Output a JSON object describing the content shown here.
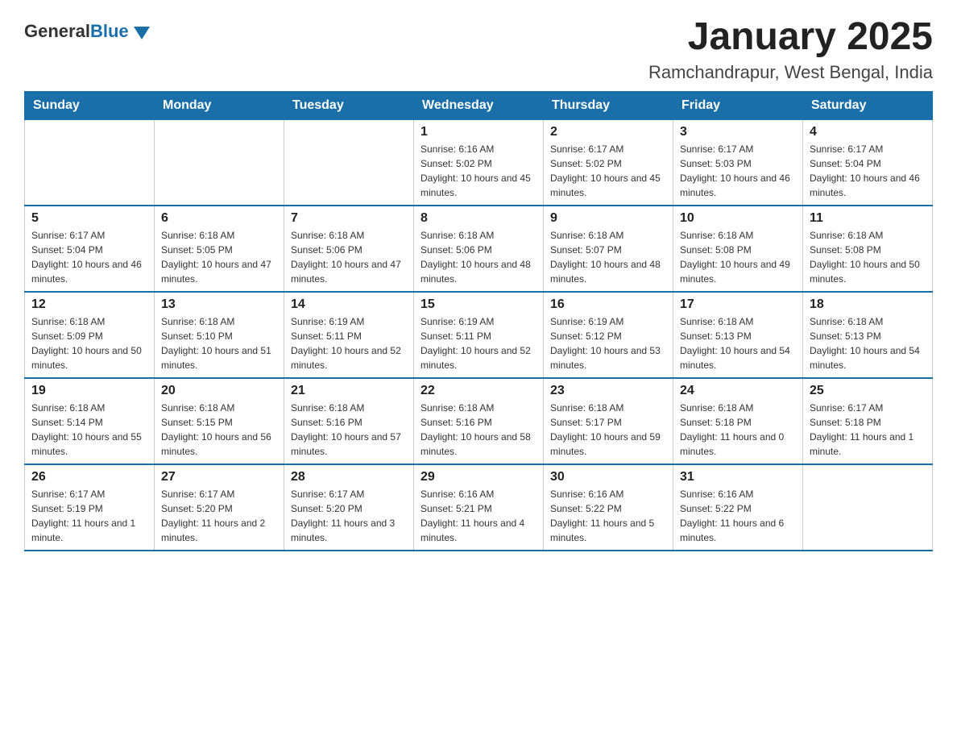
{
  "logo": {
    "text_general": "General",
    "text_blue": "Blue"
  },
  "title": "January 2025",
  "subtitle": "Ramchandrapur, West Bengal, India",
  "weekdays": [
    "Sunday",
    "Monday",
    "Tuesday",
    "Wednesday",
    "Thursday",
    "Friday",
    "Saturday"
  ],
  "weeks": [
    [
      {
        "day": "",
        "info": ""
      },
      {
        "day": "",
        "info": ""
      },
      {
        "day": "",
        "info": ""
      },
      {
        "day": "1",
        "info": "Sunrise: 6:16 AM\nSunset: 5:02 PM\nDaylight: 10 hours and 45 minutes."
      },
      {
        "day": "2",
        "info": "Sunrise: 6:17 AM\nSunset: 5:02 PM\nDaylight: 10 hours and 45 minutes."
      },
      {
        "day": "3",
        "info": "Sunrise: 6:17 AM\nSunset: 5:03 PM\nDaylight: 10 hours and 46 minutes."
      },
      {
        "day": "4",
        "info": "Sunrise: 6:17 AM\nSunset: 5:04 PM\nDaylight: 10 hours and 46 minutes."
      }
    ],
    [
      {
        "day": "5",
        "info": "Sunrise: 6:17 AM\nSunset: 5:04 PM\nDaylight: 10 hours and 46 minutes."
      },
      {
        "day": "6",
        "info": "Sunrise: 6:18 AM\nSunset: 5:05 PM\nDaylight: 10 hours and 47 minutes."
      },
      {
        "day": "7",
        "info": "Sunrise: 6:18 AM\nSunset: 5:06 PM\nDaylight: 10 hours and 47 minutes."
      },
      {
        "day": "8",
        "info": "Sunrise: 6:18 AM\nSunset: 5:06 PM\nDaylight: 10 hours and 48 minutes."
      },
      {
        "day": "9",
        "info": "Sunrise: 6:18 AM\nSunset: 5:07 PM\nDaylight: 10 hours and 48 minutes."
      },
      {
        "day": "10",
        "info": "Sunrise: 6:18 AM\nSunset: 5:08 PM\nDaylight: 10 hours and 49 minutes."
      },
      {
        "day": "11",
        "info": "Sunrise: 6:18 AM\nSunset: 5:08 PM\nDaylight: 10 hours and 50 minutes."
      }
    ],
    [
      {
        "day": "12",
        "info": "Sunrise: 6:18 AM\nSunset: 5:09 PM\nDaylight: 10 hours and 50 minutes."
      },
      {
        "day": "13",
        "info": "Sunrise: 6:18 AM\nSunset: 5:10 PM\nDaylight: 10 hours and 51 minutes."
      },
      {
        "day": "14",
        "info": "Sunrise: 6:19 AM\nSunset: 5:11 PM\nDaylight: 10 hours and 52 minutes."
      },
      {
        "day": "15",
        "info": "Sunrise: 6:19 AM\nSunset: 5:11 PM\nDaylight: 10 hours and 52 minutes."
      },
      {
        "day": "16",
        "info": "Sunrise: 6:19 AM\nSunset: 5:12 PM\nDaylight: 10 hours and 53 minutes."
      },
      {
        "day": "17",
        "info": "Sunrise: 6:18 AM\nSunset: 5:13 PM\nDaylight: 10 hours and 54 minutes."
      },
      {
        "day": "18",
        "info": "Sunrise: 6:18 AM\nSunset: 5:13 PM\nDaylight: 10 hours and 54 minutes."
      }
    ],
    [
      {
        "day": "19",
        "info": "Sunrise: 6:18 AM\nSunset: 5:14 PM\nDaylight: 10 hours and 55 minutes."
      },
      {
        "day": "20",
        "info": "Sunrise: 6:18 AM\nSunset: 5:15 PM\nDaylight: 10 hours and 56 minutes."
      },
      {
        "day": "21",
        "info": "Sunrise: 6:18 AM\nSunset: 5:16 PM\nDaylight: 10 hours and 57 minutes."
      },
      {
        "day": "22",
        "info": "Sunrise: 6:18 AM\nSunset: 5:16 PM\nDaylight: 10 hours and 58 minutes."
      },
      {
        "day": "23",
        "info": "Sunrise: 6:18 AM\nSunset: 5:17 PM\nDaylight: 10 hours and 59 minutes."
      },
      {
        "day": "24",
        "info": "Sunrise: 6:18 AM\nSunset: 5:18 PM\nDaylight: 11 hours and 0 minutes."
      },
      {
        "day": "25",
        "info": "Sunrise: 6:17 AM\nSunset: 5:18 PM\nDaylight: 11 hours and 1 minute."
      }
    ],
    [
      {
        "day": "26",
        "info": "Sunrise: 6:17 AM\nSunset: 5:19 PM\nDaylight: 11 hours and 1 minute."
      },
      {
        "day": "27",
        "info": "Sunrise: 6:17 AM\nSunset: 5:20 PM\nDaylight: 11 hours and 2 minutes."
      },
      {
        "day": "28",
        "info": "Sunrise: 6:17 AM\nSunset: 5:20 PM\nDaylight: 11 hours and 3 minutes."
      },
      {
        "day": "29",
        "info": "Sunrise: 6:16 AM\nSunset: 5:21 PM\nDaylight: 11 hours and 4 minutes."
      },
      {
        "day": "30",
        "info": "Sunrise: 6:16 AM\nSunset: 5:22 PM\nDaylight: 11 hours and 5 minutes."
      },
      {
        "day": "31",
        "info": "Sunrise: 6:16 AM\nSunset: 5:22 PM\nDaylight: 11 hours and 6 minutes."
      },
      {
        "day": "",
        "info": ""
      }
    ]
  ]
}
